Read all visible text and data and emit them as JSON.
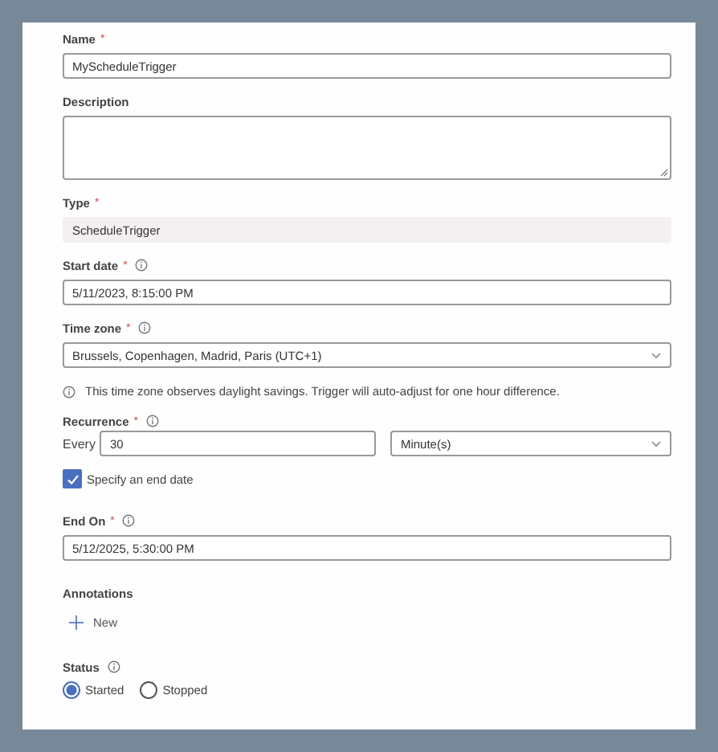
{
  "fields": [
    {
      "kind": "text",
      "label": "Name",
      "mark": "*",
      "info": false,
      "value": "MyScheduleTrigger"
    },
    {
      "kind": "textarea",
      "label": "Description"
    },
    {
      "kind": "readonly",
      "label": "Type",
      "mark": "*",
      "value": "ScheduleTrigger"
    },
    {
      "kind": "text",
      "label": "Start date",
      "mark": "*",
      "info": true,
      "value": "5/11/2023, 8:15:00 PM"
    },
    {
      "kind": "select",
      "label": "Time zone",
      "mark": "*",
      "info": true,
      "value": "Brussels, Copenhagen, Madrid, Paris (UTC+1)",
      "note": "This time zone observes daylight savings. Trigger will auto-adjust for one hour difference."
    },
    {
      "kind": "recurrence",
      "label": "Recurrence",
      "mark": "*",
      "info": true,
      "prefix": "Every",
      "interval": "30",
      "unit": "Minute(s)"
    },
    {
      "kind": "checkbox",
      "label": "Specify an end date",
      "checked": true
    },
    {
      "kind": "text",
      "label": "End On",
      "mark": "*",
      "info": true,
      "value": "5/12/2025, 5:30:00 PM"
    },
    {
      "kind": "annotations",
      "label": "Annotations",
      "action": "New"
    },
    {
      "kind": "radio",
      "label": "Status",
      "info": true,
      "options": [
        {
          "label": "Started",
          "selected": true
        },
        {
          "label": "Stopped",
          "selected": false
        }
      ]
    }
  ]
}
